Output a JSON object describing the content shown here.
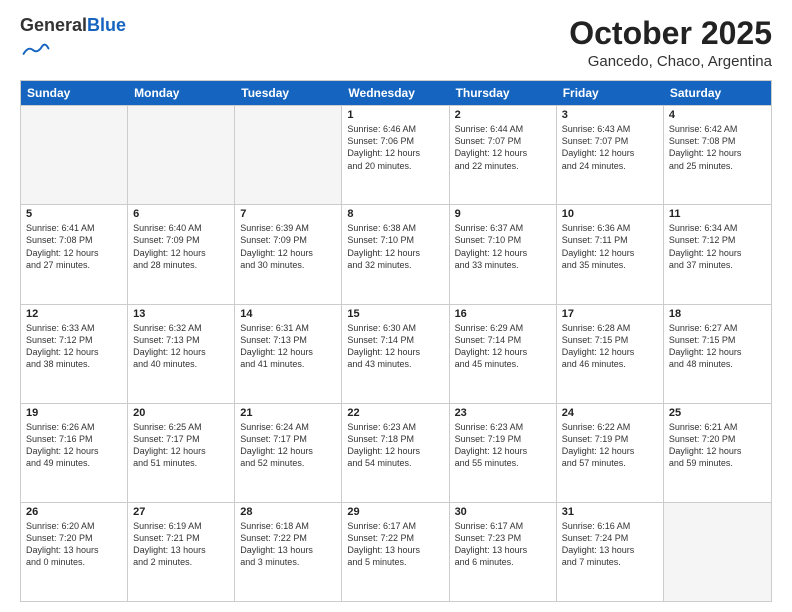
{
  "header": {
    "logo_general": "General",
    "logo_blue": "Blue",
    "month_title": "October 2025",
    "location": "Gancedo, Chaco, Argentina"
  },
  "weekdays": [
    "Sunday",
    "Monday",
    "Tuesday",
    "Wednesday",
    "Thursday",
    "Friday",
    "Saturday"
  ],
  "rows": [
    [
      {
        "day": "",
        "info": ""
      },
      {
        "day": "",
        "info": ""
      },
      {
        "day": "",
        "info": ""
      },
      {
        "day": "1",
        "info": "Sunrise: 6:46 AM\nSunset: 7:06 PM\nDaylight: 12 hours\nand 20 minutes."
      },
      {
        "day": "2",
        "info": "Sunrise: 6:44 AM\nSunset: 7:07 PM\nDaylight: 12 hours\nand 22 minutes."
      },
      {
        "day": "3",
        "info": "Sunrise: 6:43 AM\nSunset: 7:07 PM\nDaylight: 12 hours\nand 24 minutes."
      },
      {
        "day": "4",
        "info": "Sunrise: 6:42 AM\nSunset: 7:08 PM\nDaylight: 12 hours\nand 25 minutes."
      }
    ],
    [
      {
        "day": "5",
        "info": "Sunrise: 6:41 AM\nSunset: 7:08 PM\nDaylight: 12 hours\nand 27 minutes."
      },
      {
        "day": "6",
        "info": "Sunrise: 6:40 AM\nSunset: 7:09 PM\nDaylight: 12 hours\nand 28 minutes."
      },
      {
        "day": "7",
        "info": "Sunrise: 6:39 AM\nSunset: 7:09 PM\nDaylight: 12 hours\nand 30 minutes."
      },
      {
        "day": "8",
        "info": "Sunrise: 6:38 AM\nSunset: 7:10 PM\nDaylight: 12 hours\nand 32 minutes."
      },
      {
        "day": "9",
        "info": "Sunrise: 6:37 AM\nSunset: 7:10 PM\nDaylight: 12 hours\nand 33 minutes."
      },
      {
        "day": "10",
        "info": "Sunrise: 6:36 AM\nSunset: 7:11 PM\nDaylight: 12 hours\nand 35 minutes."
      },
      {
        "day": "11",
        "info": "Sunrise: 6:34 AM\nSunset: 7:12 PM\nDaylight: 12 hours\nand 37 minutes."
      }
    ],
    [
      {
        "day": "12",
        "info": "Sunrise: 6:33 AM\nSunset: 7:12 PM\nDaylight: 12 hours\nand 38 minutes."
      },
      {
        "day": "13",
        "info": "Sunrise: 6:32 AM\nSunset: 7:13 PM\nDaylight: 12 hours\nand 40 minutes."
      },
      {
        "day": "14",
        "info": "Sunrise: 6:31 AM\nSunset: 7:13 PM\nDaylight: 12 hours\nand 41 minutes."
      },
      {
        "day": "15",
        "info": "Sunrise: 6:30 AM\nSunset: 7:14 PM\nDaylight: 12 hours\nand 43 minutes."
      },
      {
        "day": "16",
        "info": "Sunrise: 6:29 AM\nSunset: 7:14 PM\nDaylight: 12 hours\nand 45 minutes."
      },
      {
        "day": "17",
        "info": "Sunrise: 6:28 AM\nSunset: 7:15 PM\nDaylight: 12 hours\nand 46 minutes."
      },
      {
        "day": "18",
        "info": "Sunrise: 6:27 AM\nSunset: 7:15 PM\nDaylight: 12 hours\nand 48 minutes."
      }
    ],
    [
      {
        "day": "19",
        "info": "Sunrise: 6:26 AM\nSunset: 7:16 PM\nDaylight: 12 hours\nand 49 minutes."
      },
      {
        "day": "20",
        "info": "Sunrise: 6:25 AM\nSunset: 7:17 PM\nDaylight: 12 hours\nand 51 minutes."
      },
      {
        "day": "21",
        "info": "Sunrise: 6:24 AM\nSunset: 7:17 PM\nDaylight: 12 hours\nand 52 minutes."
      },
      {
        "day": "22",
        "info": "Sunrise: 6:23 AM\nSunset: 7:18 PM\nDaylight: 12 hours\nand 54 minutes."
      },
      {
        "day": "23",
        "info": "Sunrise: 6:23 AM\nSunset: 7:19 PM\nDaylight: 12 hours\nand 55 minutes."
      },
      {
        "day": "24",
        "info": "Sunrise: 6:22 AM\nSunset: 7:19 PM\nDaylight: 12 hours\nand 57 minutes."
      },
      {
        "day": "25",
        "info": "Sunrise: 6:21 AM\nSunset: 7:20 PM\nDaylight: 12 hours\nand 59 minutes."
      }
    ],
    [
      {
        "day": "26",
        "info": "Sunrise: 6:20 AM\nSunset: 7:20 PM\nDaylight: 13 hours\nand 0 minutes."
      },
      {
        "day": "27",
        "info": "Sunrise: 6:19 AM\nSunset: 7:21 PM\nDaylight: 13 hours\nand 2 minutes."
      },
      {
        "day": "28",
        "info": "Sunrise: 6:18 AM\nSunset: 7:22 PM\nDaylight: 13 hours\nand 3 minutes."
      },
      {
        "day": "29",
        "info": "Sunrise: 6:17 AM\nSunset: 7:22 PM\nDaylight: 13 hours\nand 5 minutes."
      },
      {
        "day": "30",
        "info": "Sunrise: 6:17 AM\nSunset: 7:23 PM\nDaylight: 13 hours\nand 6 minutes."
      },
      {
        "day": "31",
        "info": "Sunrise: 6:16 AM\nSunset: 7:24 PM\nDaylight: 13 hours\nand 7 minutes."
      },
      {
        "day": "",
        "info": ""
      }
    ]
  ]
}
